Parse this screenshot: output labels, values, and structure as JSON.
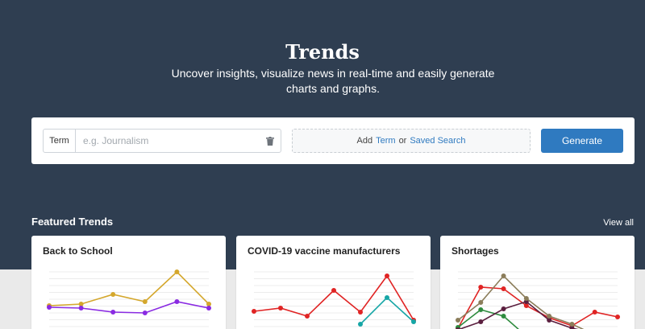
{
  "hero": {
    "title": "Trends",
    "subtitle": "Uncover insights, visualize news in real-time and easily generate charts and graphs."
  },
  "search": {
    "term_label": "Term",
    "placeholder": "e.g. Journalism",
    "value": "",
    "add_prefix": "Add",
    "add_term_link": "Term",
    "add_or": "or",
    "add_saved_link": "Saved Search",
    "generate_label": "Generate",
    "accent": "#2f7ac0"
  },
  "featured": {
    "heading": "Featured Trends",
    "view_all": "View all",
    "cards": [
      {
        "title": "Back to School",
        "chart_data": {
          "type": "line",
          "series": [
            {
              "color": "#d4a72c",
              "values": [
                58,
                60,
                72,
                63,
                100,
                60
              ]
            },
            {
              "color": "#8a2be2",
              "values": [
                56,
                55,
                50,
                49,
                63,
                55
              ]
            }
          ]
        }
      },
      {
        "title": "COVID-19 vaccine manufacturers",
        "chart_data": {
          "type": "line",
          "series": [
            {
              "color": "#e02424",
              "values": [
                51,
                55,
                45,
                77,
                50,
                95,
                40
              ]
            },
            {
              "color": "#16a6a6",
              "values": [
                null,
                null,
                null,
                null,
                35,
                68,
                38
              ]
            }
          ]
        }
      },
      {
        "title": "Shortages",
        "chart_data": {
          "type": "line",
          "series": [
            {
              "color": "#e02424",
              "values": [
                30,
                81,
                79,
                58,
                43,
                33,
                50,
                44
              ]
            },
            {
              "color": "#2e8b3e",
              "values": [
                31,
                53,
                45,
                20,
                18,
                22,
                20,
                20
              ]
            },
            {
              "color": "#5b1f3f",
              "values": [
                28,
                38,
                54,
                63,
                40,
                30,
                24,
                23
              ]
            },
            {
              "color": "#8b7d5a",
              "values": [
                40,
                62,
                95,
                67,
                45,
                35,
                22,
                20
              ]
            }
          ]
        }
      }
    ]
  }
}
